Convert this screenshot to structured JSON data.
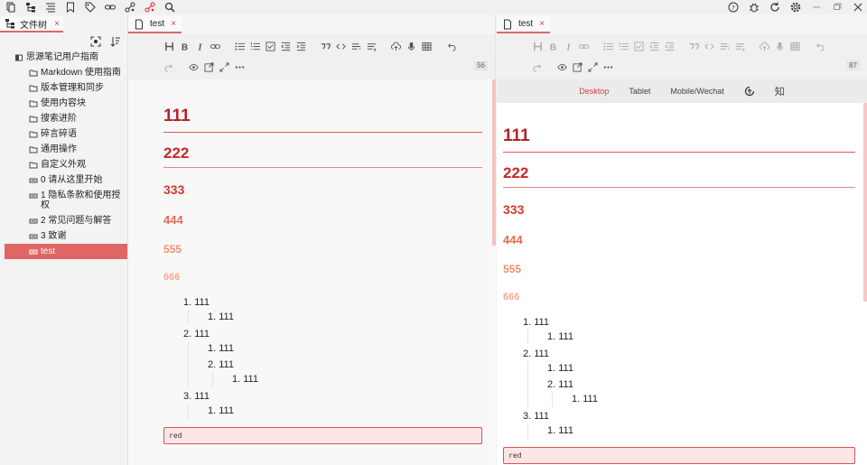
{
  "topbar": {
    "left_icons": [
      "files-icon",
      "tree-icon",
      "outline-icon",
      "bookmark-icon",
      "tag-icon",
      "link-icon",
      "graph-icon",
      "global-graph-icon",
      "search-icon"
    ],
    "right_icons": [
      "help-icon",
      "bug-icon",
      "sync-icon",
      "settings-icon"
    ],
    "window_controls": [
      "minimize",
      "restore",
      "close"
    ]
  },
  "sidebar": {
    "tab_label": "文件树",
    "notebook": "思源笔记用户指南",
    "items": [
      {
        "label": "Markdown 使用指南",
        "type": "folder"
      },
      {
        "label": "版本管理和同步",
        "type": "folder"
      },
      {
        "label": "使用内容块",
        "type": "folder"
      },
      {
        "label": "搜索进阶",
        "type": "folder"
      },
      {
        "label": "碎言碎语",
        "type": "folder"
      },
      {
        "label": "通用操作",
        "type": "folder"
      },
      {
        "label": "自定义外观",
        "type": "folder"
      },
      {
        "label": "0 请从这里开始",
        "type": "doc"
      },
      {
        "label": "1 隐私条款和使用授权",
        "type": "doc"
      },
      {
        "label": "2 常见问题与解答",
        "type": "doc"
      },
      {
        "label": "3 致谢",
        "type": "doc"
      },
      {
        "label": "test",
        "type": "doc",
        "active": true
      }
    ]
  },
  "editor": {
    "tab_label": "test",
    "count": "56",
    "headings": [
      "111",
      "222",
      "333",
      "444",
      "555",
      "666"
    ],
    "list": {
      "i1": "1. 111",
      "i1a": "1. 111",
      "i2": "2. 111",
      "i2a": "1. 111",
      "i2b": "2. 111",
      "i2b1": "1. 111",
      "i3": "3. 111",
      "i3a": "1. 111"
    },
    "code": "red"
  },
  "preview": {
    "tab_label": "test",
    "count": "87",
    "modes": [
      "Desktop",
      "Tablet",
      "Mobile/Wechat"
    ],
    "active_mode": "Desktop",
    "zhihu": "知"
  },
  "colors": {
    "accent": "#e06565",
    "h1": "#b5232a",
    "h2": "#c62828",
    "h3": "#d03a2f",
    "h4": "#e46b4f",
    "h5": "#ef8f72",
    "h6": "#f2a994"
  }
}
